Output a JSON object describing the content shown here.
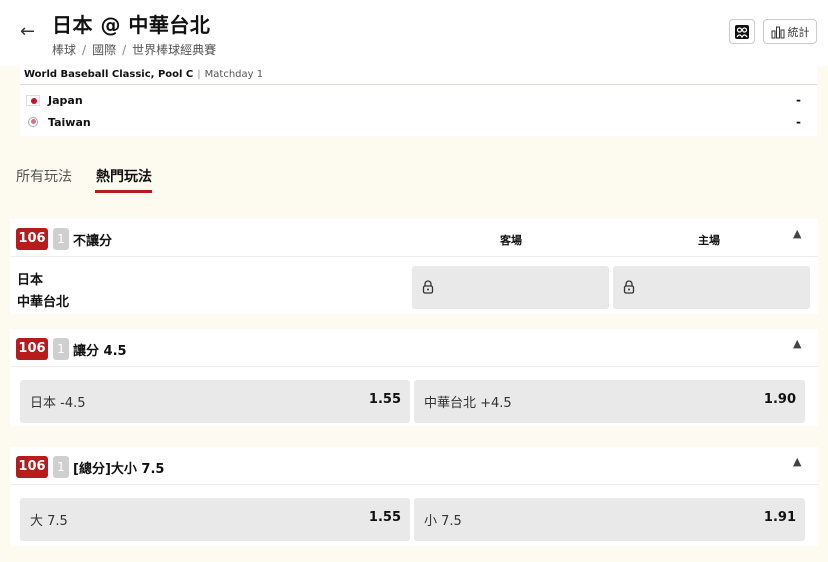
{
  "header": {
    "title": "日本 @ 中華台北",
    "breadcrumbs": [
      "棒球",
      "國際",
      "世界棒球經典賽"
    ],
    "stats_label": "統計"
  },
  "match": {
    "competition": "World Baseball Classic, Pool C",
    "matchday": "Matchday 1",
    "teams": [
      {
        "name": "Japan",
        "score": "-"
      },
      {
        "name": "Taiwan",
        "score": "-"
      }
    ]
  },
  "tabs": {
    "all": "所有玩法",
    "hot": "熱門玩法"
  },
  "markets": [
    {
      "id": "106",
      "count": "1",
      "name": "不讓分",
      "col_away": "客場",
      "col_home": "主場",
      "team_home": "日本",
      "team_away": "中華台北"
    },
    {
      "id": "106",
      "count": "1",
      "name": "讓分 4.5",
      "selections": [
        {
          "label": "日本 -4.5",
          "odds": "1.55"
        },
        {
          "label": "中華台北 +4.5",
          "odds": "1.90"
        }
      ]
    },
    {
      "id": "106",
      "count": "1",
      "name": "[總分]大小 7.5",
      "selections": [
        {
          "label": "大 7.5",
          "odds": "1.55"
        },
        {
          "label": "小 7.5",
          "odds": "1.91"
        }
      ]
    }
  ]
}
